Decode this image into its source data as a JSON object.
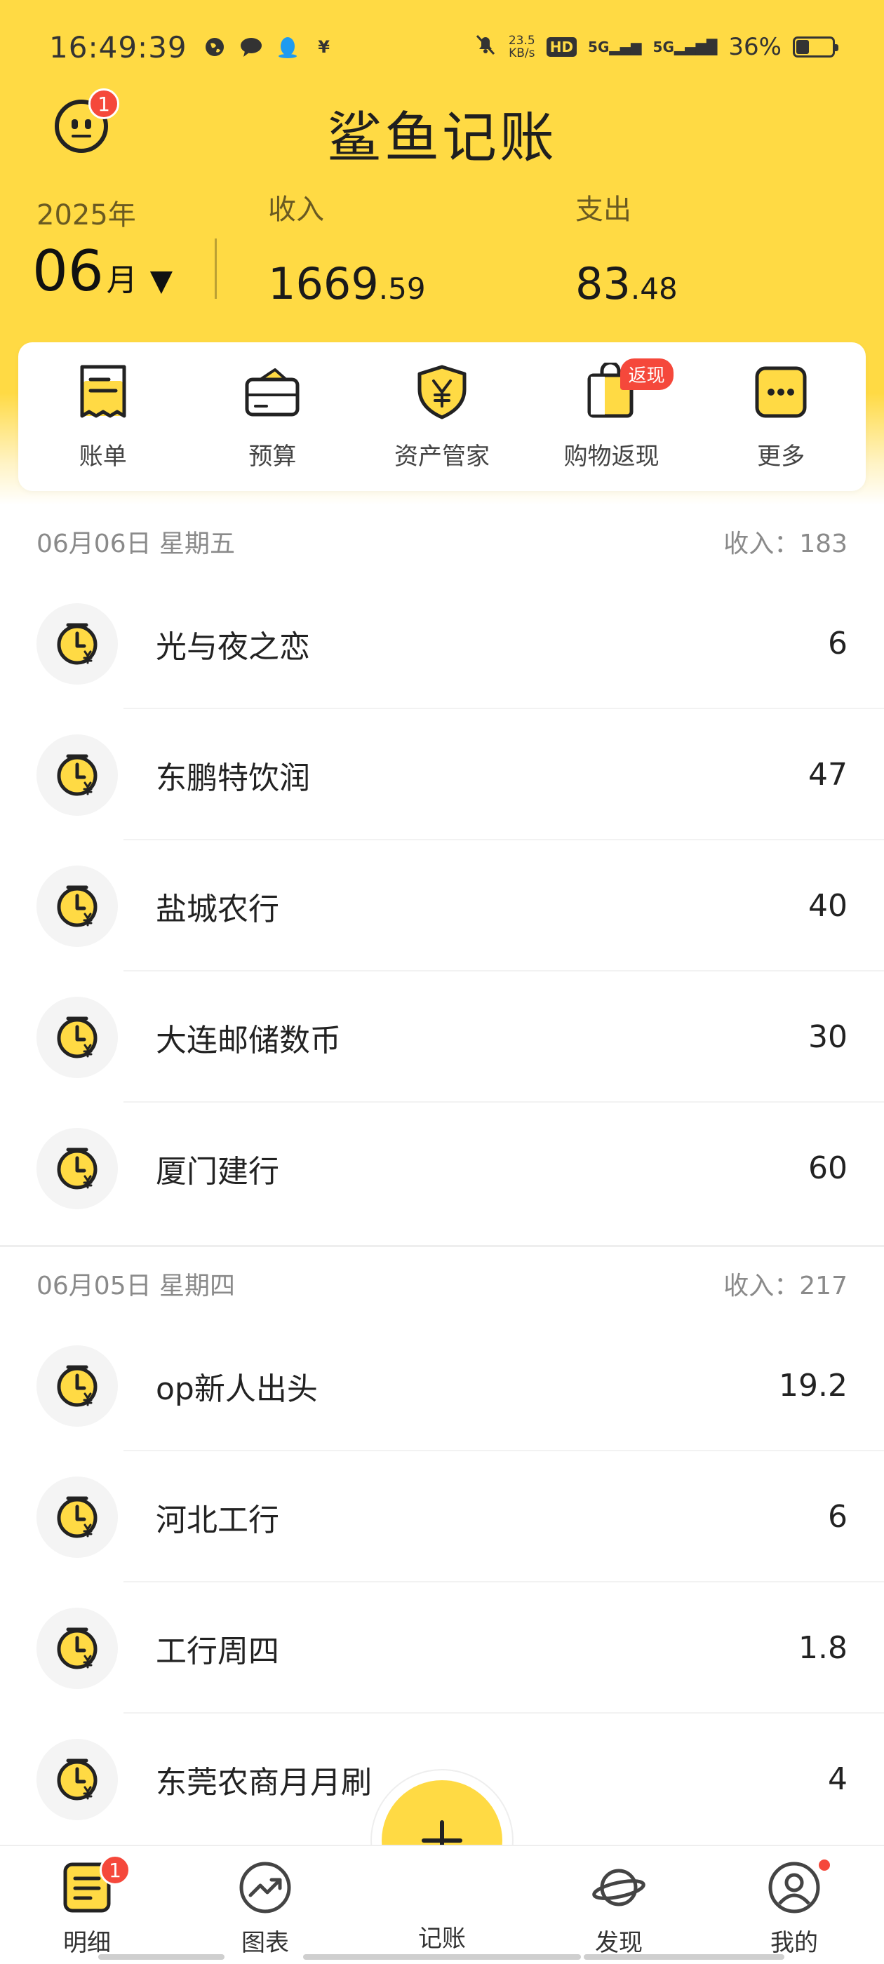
{
  "status_bar": {
    "time": "16:49:39",
    "net_speed_top": "23.5",
    "net_speed_bottom": "KB/s",
    "hd_label": "HD",
    "sig1": "5G",
    "sig2": "5G",
    "battery_pct": "36%",
    "battery_level": 0.36
  },
  "app": {
    "title": "鲨鱼记账",
    "avatar_badge": "1"
  },
  "summary": {
    "year": "2025年",
    "month_num": "06",
    "month_unit": "月",
    "month_arrow": "▼",
    "income_label": "收入",
    "income_int": "1669",
    "income_dec": ".59",
    "expense_label": "支出",
    "expense_int": "83",
    "expense_dec": ".48"
  },
  "quick_actions": [
    {
      "label": "账单",
      "icon": "receipt-icon"
    },
    {
      "label": "预算",
      "icon": "wallet-icon"
    },
    {
      "label": "资产管家",
      "icon": "shield-yen-icon"
    },
    {
      "label": "购物返现",
      "icon": "shopping-bag-icon",
      "ribbon": "返现"
    },
    {
      "label": "更多",
      "icon": "more-dots-icon"
    }
  ],
  "days": [
    {
      "date": "06月06日 星期五",
      "income_label": "收入：",
      "income_total": "183",
      "items": [
        {
          "name": "光与夜之恋",
          "amount": "6"
        },
        {
          "name": "东鹏特饮润",
          "amount": "47"
        },
        {
          "name": "盐城农行",
          "amount": "40"
        },
        {
          "name": "大连邮储数币",
          "amount": "30"
        },
        {
          "name": "厦门建行",
          "amount": "60"
        }
      ]
    },
    {
      "date": "06月05日 星期四",
      "income_label": "收入：",
      "income_total": "217",
      "items": [
        {
          "name": "op新人出头",
          "amount": "19.2"
        },
        {
          "name": "河北工行",
          "amount": "6"
        },
        {
          "name": "工行周四",
          "amount": "1.8"
        },
        {
          "name": "东莞农商月月刷",
          "amount": "4"
        }
      ]
    }
  ],
  "tabbar": {
    "details": "明细",
    "details_badge": "1",
    "charts": "图表",
    "record": "记账",
    "discover": "发现",
    "mine": "我的"
  },
  "colors": {
    "brand_yellow": "#FFDA44",
    "badge_red": "#F5483B"
  }
}
